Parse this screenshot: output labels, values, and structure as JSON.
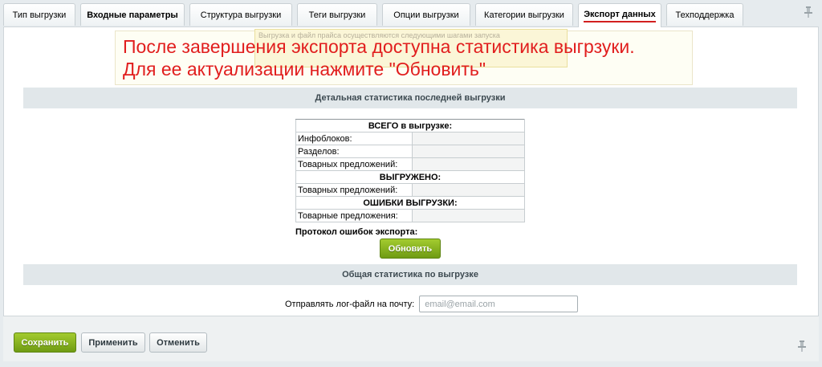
{
  "tabs": [
    {
      "label": "Тип выгрузки"
    },
    {
      "label": "Входные параметры"
    },
    {
      "label": "Структура выгрузки"
    },
    {
      "label": "Теги выгрузки"
    },
    {
      "label": "Опции выгрузки"
    },
    {
      "label": "Категории выгрузки"
    },
    {
      "label": "Экспорт данных"
    },
    {
      "label": "Техподдержка"
    }
  ],
  "notice": {
    "faded_text": "Выгрузка и файл прайса осуществляются следующими шагами запуска",
    "line1": "После завершения экспорта доступна статистика выгрзуки.",
    "line2": "Для ее актуализации нажмите \"Обновить\"",
    "color": "#e11e1e"
  },
  "detail_section": {
    "title": "Детальная статистика последней выгрузки"
  },
  "stats": {
    "total_heading": "ВСЕГО в выгрузке:",
    "infoblocks": "Инфоблоков:",
    "sections": "Разделов:",
    "offers": "Товарных предложений:",
    "uploaded_heading": "ВЫГРУЖЕНО:",
    "uploaded_offers": "Товарных предложений:",
    "errors_heading": "ОШИБКИ ВЫГРУЗКИ:",
    "error_offers": "Товарные предложения:",
    "protocol": "Протокол ошибок экспорта:"
  },
  "refresh_button": "Обновить",
  "general_section": {
    "title": "Общая статистика по выгрузке"
  },
  "email": {
    "label": "Отправлять лог-файл на почту:",
    "value": "",
    "placeholder": "email@email.com"
  },
  "footer": {
    "save": "Сохранить",
    "apply": "Применить",
    "cancel": "Отменить"
  },
  "colors": {
    "accent_green": "#7fae1b",
    "active_tab_underline": "#d21f1f"
  }
}
